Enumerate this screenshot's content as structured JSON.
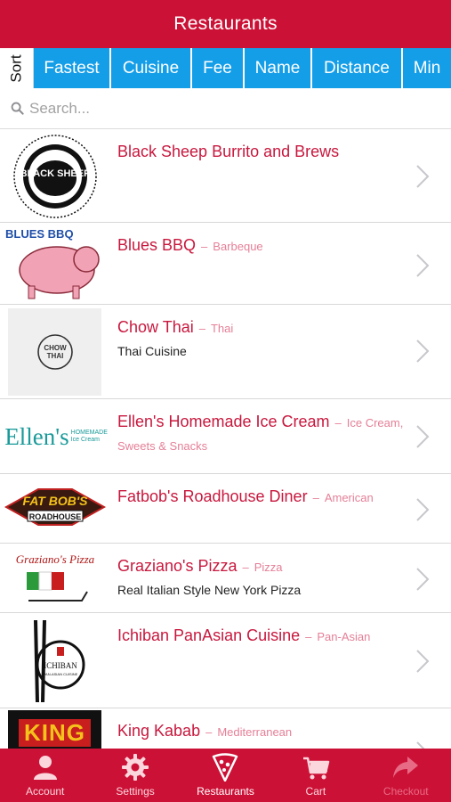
{
  "header": {
    "title": "Restaurants"
  },
  "sortbar": {
    "label": "Sort",
    "options": [
      "Fastest",
      "Cuisine",
      "Fee",
      "Name",
      "Distance",
      "Min"
    ]
  },
  "search": {
    "placeholder": "Search...",
    "value": ""
  },
  "restaurants": [
    {
      "name": "Black Sheep Burrito and Brews",
      "cuisine": "",
      "description": "",
      "logo_text": "BLACK SHEEP"
    },
    {
      "name": "Blues BBQ",
      "cuisine": "Barbeque",
      "description": "",
      "logo_text": "BLUES BBQ"
    },
    {
      "name": "Chow Thai",
      "cuisine": "Thai",
      "description": "Thai Cuisine",
      "logo_text": "CHOW THAI"
    },
    {
      "name": "Ellen's Homemade Ice Cream",
      "cuisine": "Ice Cream, Sweets & Snacks",
      "description": "",
      "logo_text": "Ellen's",
      "logo_subtext": "HOMEMADE Ice Cream"
    },
    {
      "name": "Fatbob's Roadhouse Diner",
      "cuisine": "American",
      "description": "",
      "logo_text": "FAT BOB'S",
      "logo_subtext": "ROADHOUSE"
    },
    {
      "name": "Graziano's Pizza",
      "cuisine": "Pizza",
      "description": "Real Italian Style New York Pizza",
      "logo_text": "Graziano's Pizza"
    },
    {
      "name": "Ichiban PanAsian Cuisine",
      "cuisine": "Pan-Asian",
      "description": "",
      "logo_text": "ICHIBAN",
      "logo_subtext": "PAN-ASIAN CUISINE"
    },
    {
      "name": "King Kabab",
      "cuisine": "Mediterranean",
      "description": "",
      "logo_text": "KING"
    }
  ],
  "tabbar": [
    {
      "label": "Account",
      "icon": "person-icon"
    },
    {
      "label": "Settings",
      "icon": "gear-icon"
    },
    {
      "label": "Restaurants",
      "icon": "pizza-slice-icon"
    },
    {
      "label": "Cart",
      "icon": "cart-icon"
    },
    {
      "label": "Checkout",
      "icon": "share-arrow-icon"
    }
  ],
  "colors": {
    "brand_red": "#cc1136",
    "sort_blue": "#159ee8",
    "name_red": "#c8183e",
    "cuisine_pink": "#e57f97"
  }
}
